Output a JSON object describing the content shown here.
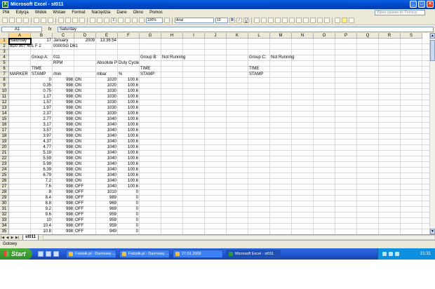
{
  "window": {
    "title": "Microsoft Excel - st011",
    "app_icon": "excel-icon",
    "btn_min": "_",
    "btn_max": "□",
    "btn_close": "×"
  },
  "menu": {
    "items": [
      "Plik",
      "Edycja",
      "Widok",
      "Wstaw",
      "Format",
      "Narzędzia",
      "Dane",
      "Okno",
      "Pomoc"
    ],
    "help_placeholder": "Wpisz pytanie do Pomocy"
  },
  "toolbar": {
    "zoom": "100%",
    "font": "Arial",
    "font_size": "10",
    "bold": "B",
    "italic": "I",
    "underline": "U",
    "sum": "Σ",
    "autosum_icon": "sigma-icon"
  },
  "formula": {
    "cell_ref": "A1",
    "fx": "fx",
    "content": "Saturday"
  },
  "grid": {
    "columns": [
      "A",
      "B",
      "C",
      "D",
      "E",
      "F",
      "G",
      "H",
      "I",
      "J",
      "K",
      "L",
      "M",
      "N",
      "O",
      "P",
      "Q",
      "R",
      "S"
    ],
    "rows": [
      "1",
      "2",
      "3",
      "4",
      "5",
      "6",
      "7",
      "8",
      "9",
      "10",
      "11",
      "12",
      "13",
      "14",
      "15",
      "16",
      "17",
      "18",
      "19",
      "20",
      "21",
      "22",
      "23",
      "24",
      "25",
      "26",
      "27",
      "28",
      "29",
      "30",
      "31",
      "32",
      "33",
      "34",
      "35"
    ],
    "header_cells": {
      "r1": {
        "A": "Saturday",
        "B": "17",
        "C": "January",
        "D": "2009",
        "E": "13:36:54"
      },
      "r2": {
        "A": "8D0 907 401 F 2",
        "C": "0000SG  D61"
      },
      "r4": {
        "B": "Group A:",
        "C": "011",
        "G": "Group B:",
        "H": "Not Running",
        "L": "Group C:",
        "M": "Not Running"
      },
      "r5": {
        "C": "RPM",
        "E": "Absolute P",
        "F": "Duty Cycle"
      },
      "r6": {
        "B": "TIME",
        "G": "TIME",
        "L": "TIME"
      },
      "r7": {
        "A": "MARKER",
        "B": "STAMP",
        "C": "/min",
        "E": "mbar",
        "F": "%",
        "G": "STAMP",
        "L": "STAMP"
      }
    },
    "data_rows": [
      {
        "time": "0",
        "rpm": "998",
        "state": "ON",
        "mbar": "1020",
        "duty": "100.6"
      },
      {
        "time": "0.35",
        "rpm": "998",
        "state": "ON",
        "mbar": "1020",
        "duty": "100.6"
      },
      {
        "time": "0.75",
        "rpm": "998",
        "state": "ON",
        "mbar": "1030",
        "duty": "100.6"
      },
      {
        "time": "1.17",
        "rpm": "998",
        "state": "ON",
        "mbar": "1030",
        "duty": "100.6"
      },
      {
        "time": "1.57",
        "rpm": "998",
        "state": "ON",
        "mbar": "1030",
        "duty": "100.6"
      },
      {
        "time": "1.97",
        "rpm": "998",
        "state": "ON",
        "mbar": "1030",
        "duty": "100.6"
      },
      {
        "time": "2.37",
        "rpm": "998",
        "state": "ON",
        "mbar": "1030",
        "duty": "100.6"
      },
      {
        "time": "2.77",
        "rpm": "998",
        "state": "ON",
        "mbar": "1040",
        "duty": "100.6"
      },
      {
        "time": "3.17",
        "rpm": "998",
        "state": "ON",
        "mbar": "1040",
        "duty": "100.6"
      },
      {
        "time": "3.57",
        "rpm": "998",
        "state": "ON",
        "mbar": "1040",
        "duty": "100.6"
      },
      {
        "time": "3.97",
        "rpm": "998",
        "state": "ON",
        "mbar": "1040",
        "duty": "100.6"
      },
      {
        "time": "4.37",
        "rpm": "998",
        "state": "ON",
        "mbar": "1040",
        "duty": "100.6"
      },
      {
        "time": "4.77",
        "rpm": "998",
        "state": "ON",
        "mbar": "1040",
        "duty": "100.6"
      },
      {
        "time": "5.19",
        "rpm": "998",
        "state": "ON",
        "mbar": "1040",
        "duty": "100.6"
      },
      {
        "time": "5.59",
        "rpm": "998",
        "state": "ON",
        "mbar": "1040",
        "duty": "100.6"
      },
      {
        "time": "5.99",
        "rpm": "998",
        "state": "ON",
        "mbar": "1040",
        "duty": "100.6"
      },
      {
        "time": "6.39",
        "rpm": "998",
        "state": "ON",
        "mbar": "1040",
        "duty": "100.6"
      },
      {
        "time": "6.79",
        "rpm": "998",
        "state": "ON",
        "mbar": "1040",
        "duty": "100.6"
      },
      {
        "time": "7.2",
        "rpm": "998",
        "state": "ON",
        "mbar": "1040",
        "duty": "100.6"
      },
      {
        "time": "7.6",
        "rpm": "998",
        "state": "OFF",
        "mbar": "1040",
        "duty": "100.6"
      },
      {
        "time": "8",
        "rpm": "998",
        "state": "OFF",
        "mbar": "1010",
        "duty": "0"
      },
      {
        "time": "8.4",
        "rpm": "998",
        "state": "OFF",
        "mbar": "989",
        "duty": "0"
      },
      {
        "time": "8.8",
        "rpm": "998",
        "state": "OFF",
        "mbar": "969",
        "duty": "0"
      },
      {
        "time": "9.2",
        "rpm": "998",
        "state": "OFF",
        "mbar": "969",
        "duty": "0"
      },
      {
        "time": "9.6",
        "rpm": "998",
        "state": "OFF",
        "mbar": "959",
        "duty": "0"
      },
      {
        "time": "10",
        "rpm": "998",
        "state": "OFF",
        "mbar": "959",
        "duty": "0"
      },
      {
        "time": "10.4",
        "rpm": "998",
        "state": "OFF",
        "mbar": "959",
        "duty": "0"
      },
      {
        "time": "10.8",
        "rpm": "998",
        "state": "OFF",
        "mbar": "949",
        "duty": "0"
      }
    ]
  },
  "sheet_tabs": {
    "nav": [
      "|◀",
      "◀",
      "▶",
      "▶|"
    ],
    "tabs": [
      "st011"
    ]
  },
  "status": {
    "text": "Gotowy"
  },
  "taskbar": {
    "start": "Start",
    "tasks": [
      {
        "label": "Fotosik.pl - Darmowy ..."
      },
      {
        "label": "Fotosik.pl - Darmowy ..."
      },
      {
        "label": "27.01.2009"
      },
      {
        "label": "Microsoft Excel - st011"
      }
    ],
    "clock": "21:31"
  }
}
